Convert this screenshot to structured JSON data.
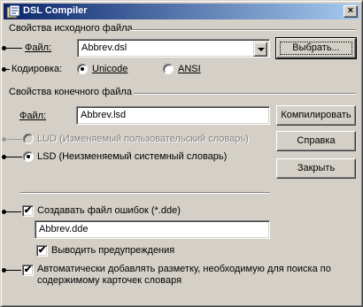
{
  "window": {
    "title": "DSL Compiler",
    "close_label": "×"
  },
  "source_group": {
    "title": "Свойства исходного файла",
    "file_label": "Файл:",
    "file_value": "Abbrev.dsl",
    "browse_button": "Выбрать...",
    "encoding_label": "Кодировка:",
    "encoding_options": [
      "Unicode",
      "ANSI"
    ],
    "encoding_selected": "Unicode"
  },
  "target_group": {
    "title": "Свойства конечного файла",
    "file_label": "Файл:",
    "file_value": "Abbrev.lsd",
    "compile_button": "Компилировать",
    "type_options": [
      {
        "label": "LUD (Изменяемый пользовательский словарь)",
        "enabled": false,
        "selected": false
      },
      {
        "label": "LSD (Неизменяемый системный словарь)",
        "enabled": true,
        "selected": true
      }
    ],
    "help_button": "Справка",
    "close_button": "Закрыть"
  },
  "errors": {
    "create_label": "Создавать файл ошибок (*.dde)",
    "create_checked": true,
    "file_value": "Abbrev.dde",
    "warnings_label": "Выводить предупреждения",
    "warnings_checked": true
  },
  "markup": {
    "label": "Автоматически добавлять разметку, необходимую для поиска по содержимому карточек словаря",
    "checked": true
  },
  "icons": {
    "app_icon": "dsl-compiler-icon",
    "combo_arrow": "chevron-down-icon",
    "check_mark": "✔"
  }
}
